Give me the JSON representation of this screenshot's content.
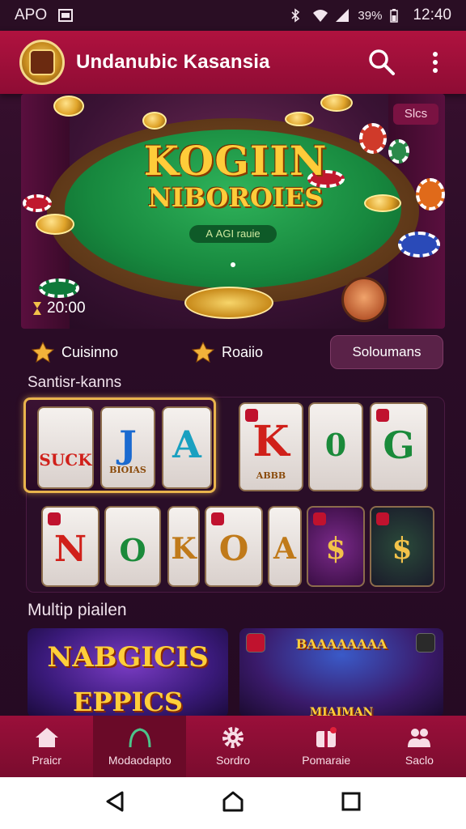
{
  "status_bar": {
    "carrier": "APO",
    "battery": "39%",
    "time": "12:40"
  },
  "app_bar": {
    "title": "Undanubic Kasansia",
    "search_icon": "search-icon",
    "menu_icon": "more-vert-icon"
  },
  "hero": {
    "title_line1": "KOGIIN",
    "title_line2": "NIBOROIES",
    "subtitle": "A AGI rauie",
    "badge": "Slcs",
    "timer": "20:00"
  },
  "categories": [
    {
      "label": "Cuisinno",
      "icon": "star-icon"
    },
    {
      "label": "Roaiio",
      "icon": "star-icon"
    },
    {
      "label": "Soloumans"
    }
  ],
  "sections": {
    "slots_label": "Santisr-kanns",
    "multiplayer_label": "Multip piailen"
  },
  "slots": {
    "row1": [
      {
        "symbol": "SUCK",
        "style": "wild"
      },
      {
        "symbol": "J",
        "caption": "BIOIAS"
      },
      {
        "symbol": "A",
        "caption": ""
      },
      {
        "symbol": "K",
        "caption": "ABBB"
      },
      {
        "symbol": "0",
        "caption": ""
      },
      {
        "symbol": "G",
        "caption": ""
      }
    ],
    "row2": [
      {
        "symbol": "N"
      },
      {
        "symbol": "O"
      },
      {
        "symbol": "K"
      },
      {
        "symbol": "O"
      },
      {
        "symbol": "A"
      },
      {
        "symbol": "$"
      },
      {
        "symbol": "$"
      }
    ]
  },
  "multiplayer": [
    {
      "title_line1": "NABGICIS",
      "title_line2": "EPPICS"
    },
    {
      "title_line1": "BAAAAAAAA",
      "title_line2": "MIAIMAN"
    }
  ],
  "bottom_nav": [
    {
      "label": "Praicr",
      "icon": "home-icon"
    },
    {
      "label": "Modaodapto",
      "icon": "person-outline-icon"
    },
    {
      "label": "Sordro",
      "icon": "gear-icon"
    },
    {
      "label": "Pomaraie",
      "icon": "gift-icon"
    },
    {
      "label": "Saclo",
      "icon": "people-icon"
    }
  ],
  "colors": {
    "brand": "#9e0f3c",
    "accent_gold": "#f2c24a",
    "felt": "#17883e"
  }
}
